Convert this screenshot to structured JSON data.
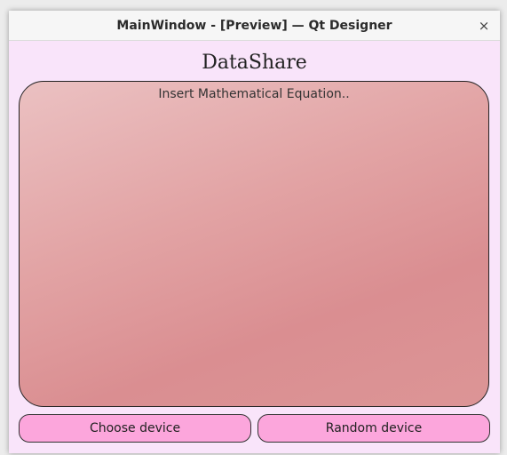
{
  "window": {
    "title": "MainWindow - [Preview] — Qt Designer",
    "close_glyph": "×"
  },
  "app": {
    "heading": "DataShare",
    "equation_placeholder": "Insert Mathematical Equation..",
    "buttons": {
      "choose_device": "Choose device",
      "random_device": "Random device"
    }
  },
  "colors": {
    "window_background": "#f9e4fa",
    "equation_gradient_start": "#ebc1c2",
    "equation_gradient_end": "#da8e91",
    "button_background": "#fca6dc"
  },
  "icons": {
    "close": "close-icon"
  }
}
